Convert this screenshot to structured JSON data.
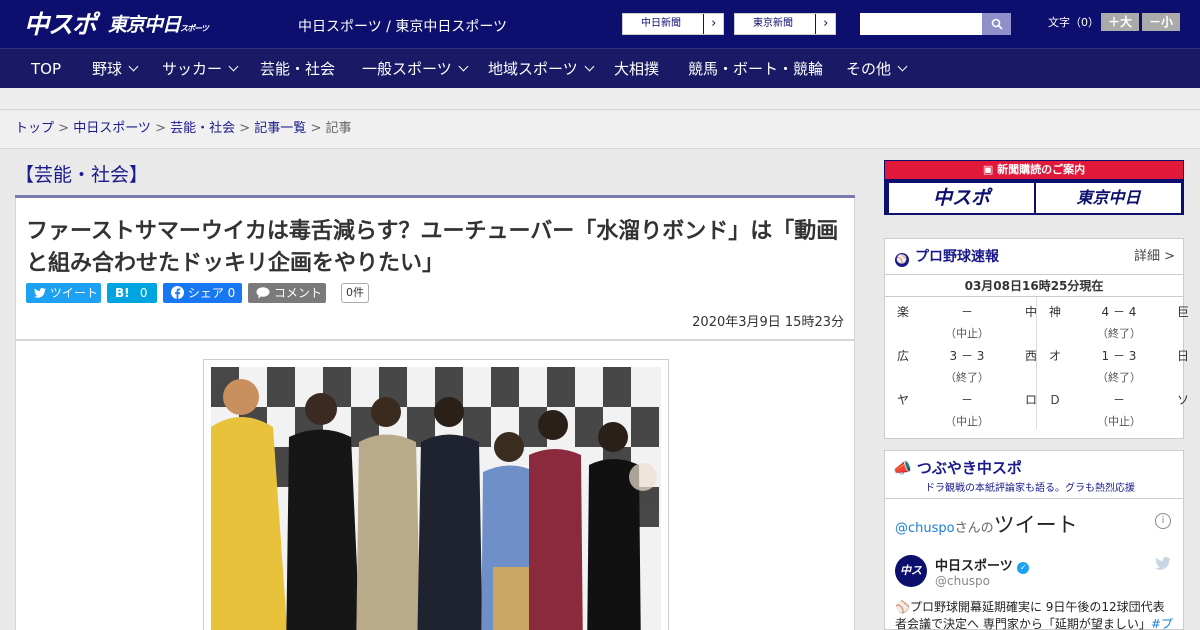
{
  "header": {
    "logo_chuspo": "中スポ",
    "logo_tokyo": "東京中日",
    "logo_tokyo_small": "スポーツ",
    "site_links": "中日スポーツ / 東京中日スポーツ",
    "paper_buttons": [
      "中日新聞",
      "東京新聞"
    ],
    "search_placeholder": "",
    "font_label": "文字（0）",
    "font_plus": "＋大",
    "font_minus": "－小"
  },
  "nav": {
    "items": [
      "TOP",
      "野球",
      "サッカー",
      "芸能・社会",
      "一般スポーツ",
      "地域スポーツ",
      "大相撲",
      "競馬・ボート・競輪",
      "その他"
    ]
  },
  "breadcrumb": {
    "items": [
      "トップ",
      "中日スポーツ",
      "芸能・社会",
      "記事一覧"
    ],
    "current": "記事",
    "sep": " > "
  },
  "article": {
    "section": "【芸能・社会】",
    "title": "ファーストサマーウイカは毒舌減らす？ユーチューバー「水溜りボンド」は「動画と組み合わせたドッキリ企画をやりたい」",
    "share": {
      "tweet": "ツイート",
      "hatena_count": "0",
      "fb_share": "シェア 0",
      "comment": "コメント",
      "comment_count": "0件"
    },
    "date": "2020年3月9日 15時23分"
  },
  "sidebar": {
    "subscription_header": "新聞購読のご案内",
    "sub_logo_1": "中スポ",
    "sub_logo_2": "東京中日",
    "baseball": {
      "title": "プロ野球速報",
      "more": "詳細 >",
      "timestamp": "03月08日16時25分現在",
      "games": [
        {
          "home": "楽",
          "score": "－",
          "away": "中",
          "status": "（中止）"
        },
        {
          "home": "神",
          "score": "4 － 4",
          "away": "巨",
          "status": "（終了）"
        },
        {
          "home": "広",
          "score": "3 － 3",
          "away": "西",
          "status": "（終了）"
        },
        {
          "home": "オ",
          "score": "1 － 3",
          "away": "日",
          "status": "（終了）"
        },
        {
          "home": "ヤ",
          "score": "－",
          "away": "ロ",
          "status": "（中止）"
        },
        {
          "home": "Ｄ",
          "score": "－",
          "away": "ソ",
          "status": "（中止）"
        }
      ]
    },
    "tweets": {
      "title": "つぶやき中スポ",
      "subtitle": "ドラ観戦の本紙評論家も語る。グラも熱烈応援",
      "handle": "@chuspo",
      "handle_suffix": "さんの",
      "widget_title": "ツイート",
      "account_name": "中日スポーツ",
      "account_handle": "@chuspo",
      "tweet_line1": "プロ野球開幕延期確実に 9日午後の12球団代表",
      "tweet_line2": "者会議で決定へ 専門家から「延期が望ましい」",
      "tweet_link": "#プ"
    }
  },
  "colors": {
    "brand_navy": "#0c0f6e",
    "accent_red": "#d81b3c",
    "twitter": "#1da1f2",
    "hatena": "#00a4de",
    "facebook": "#1877f2"
  }
}
